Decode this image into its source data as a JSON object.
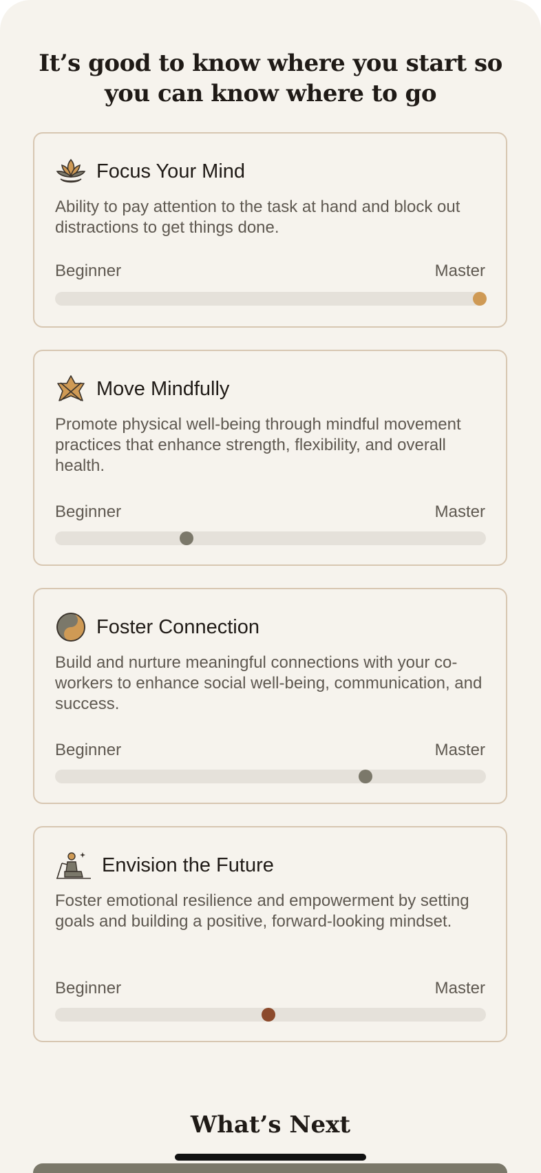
{
  "page": {
    "heading": "It’s good to know where you start so you can know where to go",
    "next_heading": "What’s Next"
  },
  "scale": {
    "left_label": "Beginner",
    "right_label": "Master"
  },
  "colors": {
    "background": "#f6f3ed",
    "card_border": "#d7c6b1",
    "track": "#e5e1da",
    "accent_gold": "#cf9a55",
    "accent_gray": "#7b786a",
    "accent_brown": "#8c4a2c",
    "button": "#7b786a"
  },
  "cards": [
    {
      "title": "Focus Your Mind",
      "icon": "lotus-icon",
      "description": "Ability to pay attention to the task at hand and block out distractions to get things done.",
      "level": 0.985,
      "thumb_color": "#cf9a55"
    },
    {
      "title": "Move Mindfully",
      "icon": "star-figure-icon",
      "description": "Promote physical well-being through mindful movement practices that enhance strength, flexibility, and overall health.",
      "level": 0.305,
      "thumb_color": "#7b786a"
    },
    {
      "title": "Foster Connection",
      "icon": "yin-yang-icon",
      "description": "Build and nurture meaningful connections with your co-workers to enhance social well-being, communication, and success.",
      "level": 0.72,
      "thumb_color": "#7b786a"
    },
    {
      "title": "Envision the Future",
      "icon": "meditating-person-icon",
      "description": "Foster emotional resilience and empowerment by setting goals and building a positive, forward-looking mindset.",
      "level": 0.495,
      "thumb_color": "#8c4a2c"
    }
  ]
}
